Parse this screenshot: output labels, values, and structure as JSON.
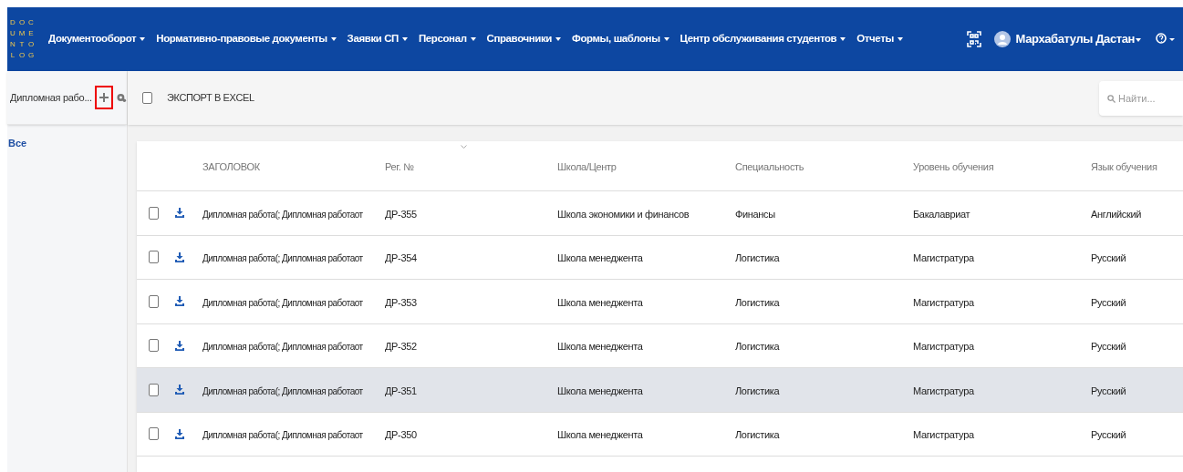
{
  "nav": {
    "logo_letters": [
      "D",
      "O",
      "C",
      "U",
      "M",
      "E",
      "N",
      "T",
      "O",
      "L",
      "O",
      "G"
    ],
    "menu": [
      {
        "label": "Документооборот"
      },
      {
        "label": "Нормативно-правовые документы"
      },
      {
        "label": "Заявки СП"
      },
      {
        "label": "Персонал"
      },
      {
        "label": "Справочники"
      },
      {
        "label": "Формы, шаблоны"
      },
      {
        "label": "Центр обслуживания студентов"
      },
      {
        "label": "Отчеты"
      }
    ],
    "user": "Мархабатулы Дастан"
  },
  "sidebar": {
    "title": "Дипломная рабо...",
    "filters": [
      {
        "label": "Все",
        "selected": true
      }
    ]
  },
  "toolbar": {
    "select_all_checked": false,
    "export_label": "ЭКСПОРТ В EXCEL",
    "search": {
      "placeholder": "Найти..."
    }
  },
  "table": {
    "columns": [
      "ЗАГОЛОВОК",
      "Рег. №",
      "Школа/Центр",
      "Специальность",
      "Уровень обучения",
      "Язык обучения"
    ],
    "rows": [
      {
        "checked": false,
        "highlighted": false,
        "cells": [
          "Дипломная работа(; Дипломная работаот",
          "ДР-355",
          "Школа экономики и финансов",
          "Финансы",
          "Бакалавриат",
          "Английский"
        ]
      },
      {
        "checked": false,
        "highlighted": false,
        "cells": [
          "Дипломная работа(; Дипломная работаот",
          "ДР-354",
          "Школа менеджента",
          "Логистика",
          "Магистратура",
          "Русский"
        ]
      },
      {
        "checked": false,
        "highlighted": false,
        "cells": [
          "Дипломная работа(; Дипломная работаот",
          "ДР-353",
          "Школа менеджента",
          "Логистика",
          "Магистратура",
          "Русский"
        ]
      },
      {
        "checked": false,
        "highlighted": false,
        "cells": [
          "Дипломная работа(; Дипломная работаот",
          "ДР-352",
          "Школа менеджента",
          "Логистика",
          "Магистратура",
          "Русский"
        ]
      },
      {
        "checked": false,
        "highlighted": true,
        "cells": [
          "Дипломная работа(; Дипломная работаот",
          "ДР-351",
          "Школа менеджента",
          "Логистика",
          "Магистратура",
          "Русский"
        ]
      },
      {
        "checked": false,
        "highlighted": false,
        "cells": [
          "Дипломная работа(; Дипломная работаот",
          "ДР-350",
          "Школа менеджента",
          "Логистика",
          "Магистратура",
          "Русский"
        ]
      }
    ]
  }
}
